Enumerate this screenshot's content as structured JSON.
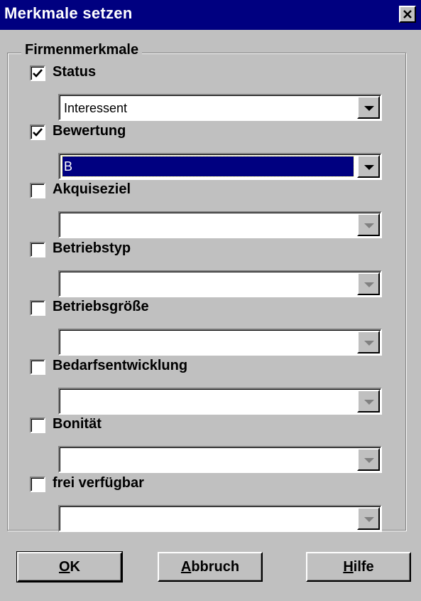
{
  "window": {
    "title": "Merkmale setzen",
    "close_glyph": "close-icon"
  },
  "group": {
    "label": "Firmenmerkmale"
  },
  "fields": [
    {
      "label": "Status",
      "checked": true,
      "value": "Interessent",
      "enabled": true,
      "focused": false
    },
    {
      "label": "Bewertung",
      "checked": true,
      "value": "B",
      "enabled": true,
      "focused": true
    },
    {
      "label": "Akquiseziel",
      "checked": false,
      "value": "",
      "enabled": false,
      "focused": false
    },
    {
      "label": "Betriebstyp",
      "checked": false,
      "value": "",
      "enabled": false,
      "focused": false
    },
    {
      "label": "Betriebsgröße",
      "checked": false,
      "value": "",
      "enabled": false,
      "focused": false
    },
    {
      "label": "Bedarfsentwicklung",
      "checked": false,
      "value": "",
      "enabled": false,
      "focused": false
    },
    {
      "label": "Bonität",
      "checked": false,
      "value": "",
      "enabled": false,
      "focused": false
    },
    {
      "label": "frei verfügbar",
      "checked": false,
      "value": "",
      "enabled": false,
      "focused": false
    }
  ],
  "buttons": {
    "ok": {
      "accel": "O",
      "rest": "K"
    },
    "cancel": {
      "accel": "A",
      "rest": "bbruch"
    },
    "help": {
      "accel": "H",
      "rest": "ilfe"
    }
  },
  "colors": {
    "titlebar": "#000080",
    "face": "#c0c0c0",
    "selection": "#000080"
  }
}
